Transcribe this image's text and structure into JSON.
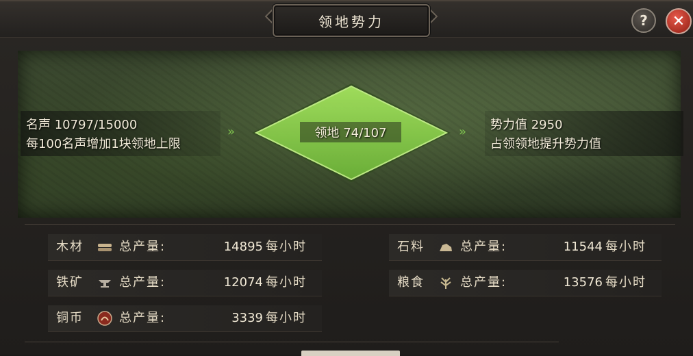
{
  "header": {
    "title": "领地势力",
    "help_label": "?",
    "close_label": "✕"
  },
  "map": {
    "fame_line": "名声 10797/15000",
    "fame_hint": "每100名声增加1块领地上限",
    "territory_label": "领地 74/107",
    "power_line": "势力值 2950",
    "power_hint": "占领领地提升势力值",
    "arrow_glyph": "»",
    "territory_color": "#8fd94a"
  },
  "resources": {
    "total_label": "总产量:",
    "unit_label": "每小时",
    "left": [
      {
        "name": "木材",
        "icon": "wood-icon",
        "value": "14895"
      },
      {
        "name": "铁矿",
        "icon": "iron-icon",
        "value": "12074"
      },
      {
        "name": "铜币",
        "icon": "coin-icon",
        "value": "3339"
      }
    ],
    "right": [
      {
        "name": "石料",
        "icon": "stone-icon",
        "value": "11544"
      },
      {
        "name": "粮食",
        "icon": "grain-icon",
        "value": "13576"
      }
    ]
  }
}
